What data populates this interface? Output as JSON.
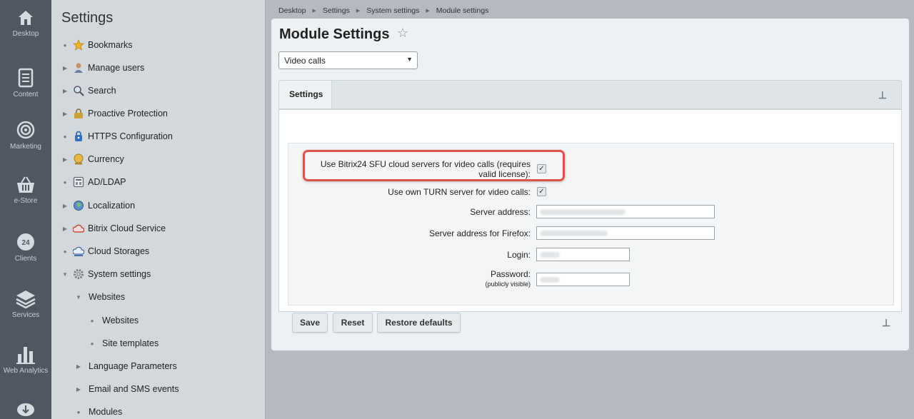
{
  "rail": {
    "items": [
      {
        "label": "Desktop",
        "icon": "home-icon"
      },
      {
        "label": "Content",
        "icon": "document-icon"
      },
      {
        "label": "Marketing",
        "icon": "target-icon"
      },
      {
        "label": "e-Store",
        "icon": "basket-icon"
      },
      {
        "label": "Clients",
        "icon": "clients-24-icon"
      },
      {
        "label": "Services",
        "icon": "layers-icon"
      },
      {
        "label": "Web Analytics",
        "icon": "bar-chart-icon"
      }
    ]
  },
  "tree": {
    "title": "Settings",
    "items": [
      {
        "label": "Bookmarks",
        "icon": "star-icon",
        "marker": "•"
      },
      {
        "label": "Manage users",
        "icon": "user-icon",
        "marker": "▶"
      },
      {
        "label": "Search",
        "icon": "magnifier-icon",
        "marker": "▶"
      },
      {
        "label": "Proactive Protection",
        "icon": "lock-icon",
        "marker": "▶"
      },
      {
        "label": "HTTPS Configuration",
        "icon": "padlock-icon",
        "marker": "•"
      },
      {
        "label": "Currency",
        "icon": "coin-icon",
        "marker": "▶"
      },
      {
        "label": "AD/LDAP",
        "icon": "directory-icon",
        "marker": "•"
      },
      {
        "label": "Localization",
        "icon": "globe-icon",
        "marker": "▶"
      },
      {
        "label": "Bitrix Cloud Service",
        "icon": "cloud-service-icon",
        "marker": "▶"
      },
      {
        "label": "Cloud Storages",
        "icon": "cloud-storage-icon",
        "marker": "•"
      },
      {
        "label": "System settings",
        "icon": "gear-icon",
        "marker": "▼"
      },
      {
        "label": "Websites",
        "icon": "",
        "marker": "▼"
      },
      {
        "label": "Websites",
        "icon": "",
        "marker": "•"
      },
      {
        "label": "Site templates",
        "icon": "",
        "marker": "•"
      },
      {
        "label": "Language Parameters",
        "icon": "",
        "marker": "▶"
      },
      {
        "label": "Email and SMS events",
        "icon": "",
        "marker": "▶"
      },
      {
        "label": "Modules",
        "icon": "",
        "marker": "•"
      }
    ]
  },
  "breadcrumb": [
    "Desktop",
    "Settings",
    "System settings",
    "Module settings"
  ],
  "page": {
    "title": "Module Settings",
    "module_select": "Video calls",
    "tab": "Settings"
  },
  "form": {
    "sfu_label": "Use Bitrix24 SFU cloud servers for video calls (requires valid license):",
    "sfu_checked": true,
    "turn_label": "Use own TURN server for video calls:",
    "turn_checked": true,
    "server_address_label": "Server address:",
    "server_address_firefox_label": "Server address for Firefox:",
    "login_label": "Login:",
    "password_label": "Password:",
    "password_hint": "(publicly visible)"
  },
  "buttons": {
    "save": "Save",
    "reset": "Reset",
    "restore": "Restore defaults"
  },
  "colors": {
    "highlight": "#e0534a",
    "rail_bg": "#4f5760",
    "tree_bg": "#d3d8dc"
  }
}
